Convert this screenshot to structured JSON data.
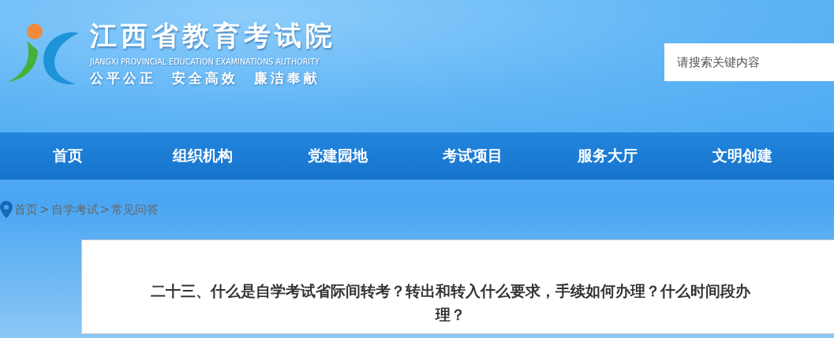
{
  "header": {
    "title": "江西省教育考试院",
    "subtitle": "JIANGXI PROVINCIAL EDUCATION EXAMINATIONS AUTHORITY",
    "motto": "公平公正  安全高效  廉洁奉献"
  },
  "search": {
    "placeholder": "请搜索关键内容"
  },
  "nav": [
    {
      "label": "首页"
    },
    {
      "label": "组织机构"
    },
    {
      "label": "党建园地"
    },
    {
      "label": "考试项目"
    },
    {
      "label": "服务大厅"
    },
    {
      "label": "文明创建"
    }
  ],
  "breadcrumb": [
    "首页",
    ">",
    "自学考试",
    ">",
    "常见问答"
  ],
  "article": {
    "title": "二十三、什么是自学考试省际间转考？转出和转入什么要求，手续如何办理？什么时间段办理？"
  }
}
